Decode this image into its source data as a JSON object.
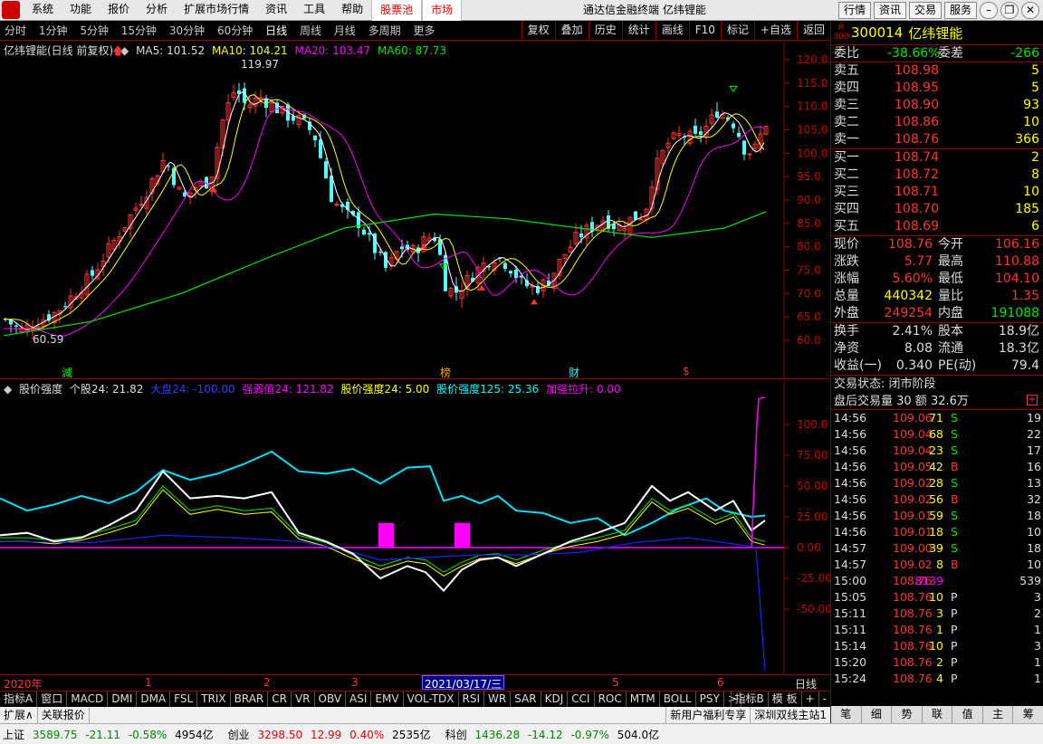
{
  "menubar": {
    "items": [
      "系统",
      "功能",
      "报价",
      "分析",
      "扩展市场行情",
      "资讯",
      "工具",
      "帮助",
      "股票池",
      "市场"
    ],
    "title": "通达信金融终端  亿纬锂能",
    "right_buttons": [
      "行情",
      "资讯",
      "交易",
      "服务"
    ]
  },
  "periodbar": {
    "periods": [
      "分时",
      "1分钟",
      "5分钟",
      "15分钟",
      "30分钟",
      "60分钟",
      "日线",
      "周线",
      "月线",
      "多周期",
      "更多"
    ],
    "active": "日线",
    "actions": [
      "复权",
      "叠加",
      "历史",
      "统计",
      "画线",
      "F10",
      "标记",
      "+自选",
      "返回"
    ]
  },
  "kchart": {
    "title": "亿纬锂能(日线 前复权)",
    "ma5": "MA5: 101.52",
    "ma10": "MA10: 104.21",
    "ma20": "MA20: 103.47",
    "ma60": "MA60: 87.73",
    "high_label": "119.97",
    "low_label": "60.59",
    "y_ticks": [
      "120.0",
      "115.0",
      "110.0",
      "105.0",
      "100.0",
      "95.0",
      "90.0",
      "85.0",
      "80.0",
      "75.0",
      "70.0",
      "65.0",
      "60.0"
    ],
    "markers": [
      "減",
      "榜",
      "财",
      "$"
    ]
  },
  "indchart": {
    "title": "股价强度",
    "values": {
      "a": "个股24: 21.82",
      "b": "大盘24: -100.00",
      "c": "强弱值24: 121.82",
      "d": "股价强度24: 5.00",
      "e": "股价强度125: 25.36",
      "f": "加强拉升: 0.00"
    },
    "y_ticks": [
      "100.0",
      "75.00",
      "50.00",
      "25.00",
      "0.00",
      "-25.00",
      "-50.00"
    ]
  },
  "xaxis": {
    "labels": [
      "2020年",
      "1",
      "2",
      "3",
      "5",
      "6"
    ],
    "cursor_date": "2021/03/17/三",
    "period_label": "日线"
  },
  "indtabs": {
    "items": [
      "指标A",
      "窗口",
      "MACD",
      "DMI",
      "DMA",
      "FSL",
      "TRIX",
      "BRAR",
      "CR",
      "VR",
      "OBV",
      "ASI",
      "EMV",
      "VOL-TDX",
      "RSI",
      "WR",
      "SAR",
      "KDJ",
      "CCI",
      "ROC",
      "MTM",
      "BOLL",
      "PSY",
      ">"
    ],
    "right": [
      "指标B",
      "模 板",
      "+",
      "-"
    ]
  },
  "extbar": {
    "items": [
      "扩展∧",
      "关联报价"
    ],
    "right": [
      "新用户福利专享",
      "深圳双线主站1"
    ]
  },
  "statusbar": {
    "sh": {
      "name": "上证",
      "value": "3589.75",
      "change": "-21.11",
      "pct": "-0.58%",
      "amount": "4954亿"
    },
    "cy": {
      "name": "创业",
      "value": "3298.50",
      "change": "12.99",
      "pct": "0.40%",
      "amount": "2535亿"
    },
    "kc": {
      "name": "科创",
      "value": "1436.28",
      "change": "-14.12",
      "pct": "-0.97%",
      "amount": "504.0亿"
    }
  },
  "quote": {
    "mark": "R 300",
    "code": "300014",
    "name": "亿纬锂能",
    "weibi_label": "委比",
    "weibi": "-38.66%",
    "weicha_label": "委差",
    "weicha": "-266",
    "asks": [
      {
        "label": "卖五",
        "price": "108.98",
        "vol": "5"
      },
      {
        "label": "卖四",
        "price": "108.95",
        "vol": "5"
      },
      {
        "label": "卖三",
        "price": "108.90",
        "vol": "93"
      },
      {
        "label": "卖二",
        "price": "108.86",
        "vol": "10"
      },
      {
        "label": "卖一",
        "price": "108.76",
        "vol": "366"
      }
    ],
    "bids": [
      {
        "label": "买一",
        "price": "108.74",
        "vol": "2"
      },
      {
        "label": "买二",
        "price": "108.72",
        "vol": "8"
      },
      {
        "label": "买三",
        "price": "108.71",
        "vol": "10"
      },
      {
        "label": "买四",
        "price": "108.70",
        "vol": "185"
      },
      {
        "label": "买五",
        "price": "108.69",
        "vol": "6"
      }
    ],
    "stats": [
      {
        "l1": "现价",
        "v1": "108.76",
        "l2": "今开",
        "v2": "106.16"
      },
      {
        "l1": "涨跌",
        "v1": "5.77",
        "l2": "最高",
        "v2": "110.88"
      },
      {
        "l1": "涨幅",
        "v1": "5.60%",
        "l2": "最低",
        "v2": "104.10"
      },
      {
        "l1": "总量",
        "v1": "440342",
        "l2": "量比",
        "v2": "1.35"
      },
      {
        "l1": "外盘",
        "v1": "249254",
        "l2": "内盘",
        "v2": "191088"
      }
    ],
    "stats2": [
      {
        "l1": "换手",
        "v1": "2.41%",
        "l2": "股本",
        "v2": "18.9亿"
      },
      {
        "l1": "净资",
        "v1": "8.08",
        "l2": "流通",
        "v2": "18.3亿"
      },
      {
        "l1": "收益(一)",
        "v1": "0.340",
        "l2": "PE(动)",
        "v2": "79.4"
      }
    ],
    "trade_state": "交易状态: 闭市阶段",
    "after_hours": "盘后交易量 30 额 32.6万",
    "ticks": [
      {
        "t": "14:56",
        "p": "109.06",
        "v": "71",
        "d": "S",
        "n": "19"
      },
      {
        "t": "14:56",
        "p": "109.04",
        "v": "68",
        "d": "S",
        "n": "22"
      },
      {
        "t": "14:56",
        "p": "109.04",
        "v": "23",
        "d": "S",
        "n": "17"
      },
      {
        "t": "14:56",
        "p": "109.05",
        "v": "42",
        "d": "B",
        "n": "16"
      },
      {
        "t": "14:56",
        "p": "109.02",
        "v": "28",
        "d": "S",
        "n": "13"
      },
      {
        "t": "14:56",
        "p": "109.02",
        "v": "56",
        "d": "B",
        "n": "32"
      },
      {
        "t": "14:56",
        "p": "109.01",
        "v": "59",
        "d": "S",
        "n": "18"
      },
      {
        "t": "14:56",
        "p": "109.01",
        "v": "18",
        "d": "S",
        "n": "10"
      },
      {
        "t": "14:57",
        "p": "109.00",
        "v": "39",
        "d": "S",
        "n": "18"
      },
      {
        "t": "14:57",
        "p": "109.02",
        "v": "8",
        "d": "B",
        "n": "10"
      },
      {
        "t": "15:00",
        "p": "108.76",
        "v": "8139",
        "d": "",
        "n": "539"
      },
      {
        "t": "15:05",
        "p": "108.76",
        "v": "10",
        "d": "P",
        "n": "3"
      },
      {
        "t": "15:11",
        "p": "108.76",
        "v": "3",
        "d": "P",
        "n": "2"
      },
      {
        "t": "15:11",
        "p": "108.76",
        "v": "1",
        "d": "P",
        "n": "1"
      },
      {
        "t": "15:14",
        "p": "108.76",
        "v": "10",
        "d": "P",
        "n": "3"
      },
      {
        "t": "15:20",
        "p": "108.76",
        "v": "2",
        "d": "P",
        "n": "1"
      },
      {
        "t": "15:24",
        "p": "108.76",
        "v": "4",
        "d": "P",
        "n": "1"
      }
    ],
    "bottom_tabs": [
      "笔",
      "细",
      "势",
      "联",
      "值",
      "主",
      "筹"
    ]
  },
  "colors": {
    "up": "#ff3232",
    "down": "#54ffff",
    "ma5": "#ffffff",
    "ma10": "#ffff00",
    "ma20": "#ff00ff",
    "ma60": "#00e600",
    "panel_border": "#800000"
  }
}
